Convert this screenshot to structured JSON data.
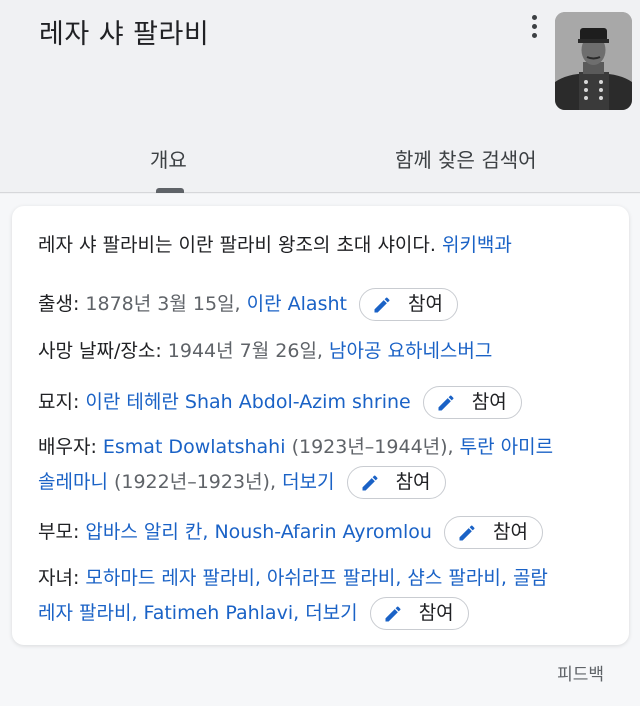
{
  "header": {
    "title": "레자 샤 팔라비",
    "thumbnail_alt": "portrait-photo"
  },
  "tabs": [
    {
      "label": "개요",
      "active": true
    },
    {
      "label": "함께 찾은 검색어",
      "active": false
    }
  ],
  "card": {
    "description": "레자 샤 팔라비는 이란 팔라비 왕조의 초대 샤이다.",
    "source": "위키백과",
    "contribute_label": "참여",
    "facts": {
      "birth": {
        "label": "출생:",
        "date": "1878년 3월 15일,",
        "place": "이란 Alasht"
      },
      "death": {
        "label": "사망 날짜/장소:",
        "date": "1944년 7월 26일,",
        "place": "남아공 요하네스버그"
      },
      "grave": {
        "label": "묘지:",
        "place": "이란 테헤란 Shah Abdol-Azim shrine"
      },
      "spouse": {
        "label": "배우자:",
        "s1_name": "Esmat Dowlatshahi",
        "s1_years": "(1923년–1944년),",
        "s2_name_a": "투란 아미르",
        "s2_name_b": "솔레마니",
        "s2_years": "(1922년–1923년),",
        "more": "더보기"
      },
      "parents": {
        "label": "부모:",
        "p1": "압바스 알리 칸,",
        "p2": "Noush-Afarin Ayromlou"
      },
      "children": {
        "label": "자녀:",
        "c1": "모하마드 레자 팔라비,",
        "c2": "아쉬라프 팔라비,",
        "c3": "샴스 팔라비,",
        "c4a": "골람",
        "c4b": "레자 팔라비,",
        "c5": "Fatimeh Pahlavi,",
        "more": "더보기"
      }
    }
  },
  "feedback_label": "피드백",
  "colors": {
    "link": "#1a62c6",
    "text": "#202124",
    "muted": "#5f6368",
    "background": "#f0f1f3"
  },
  "icons": {
    "menu": "more-vert-icon",
    "edit": "pencil-icon"
  }
}
